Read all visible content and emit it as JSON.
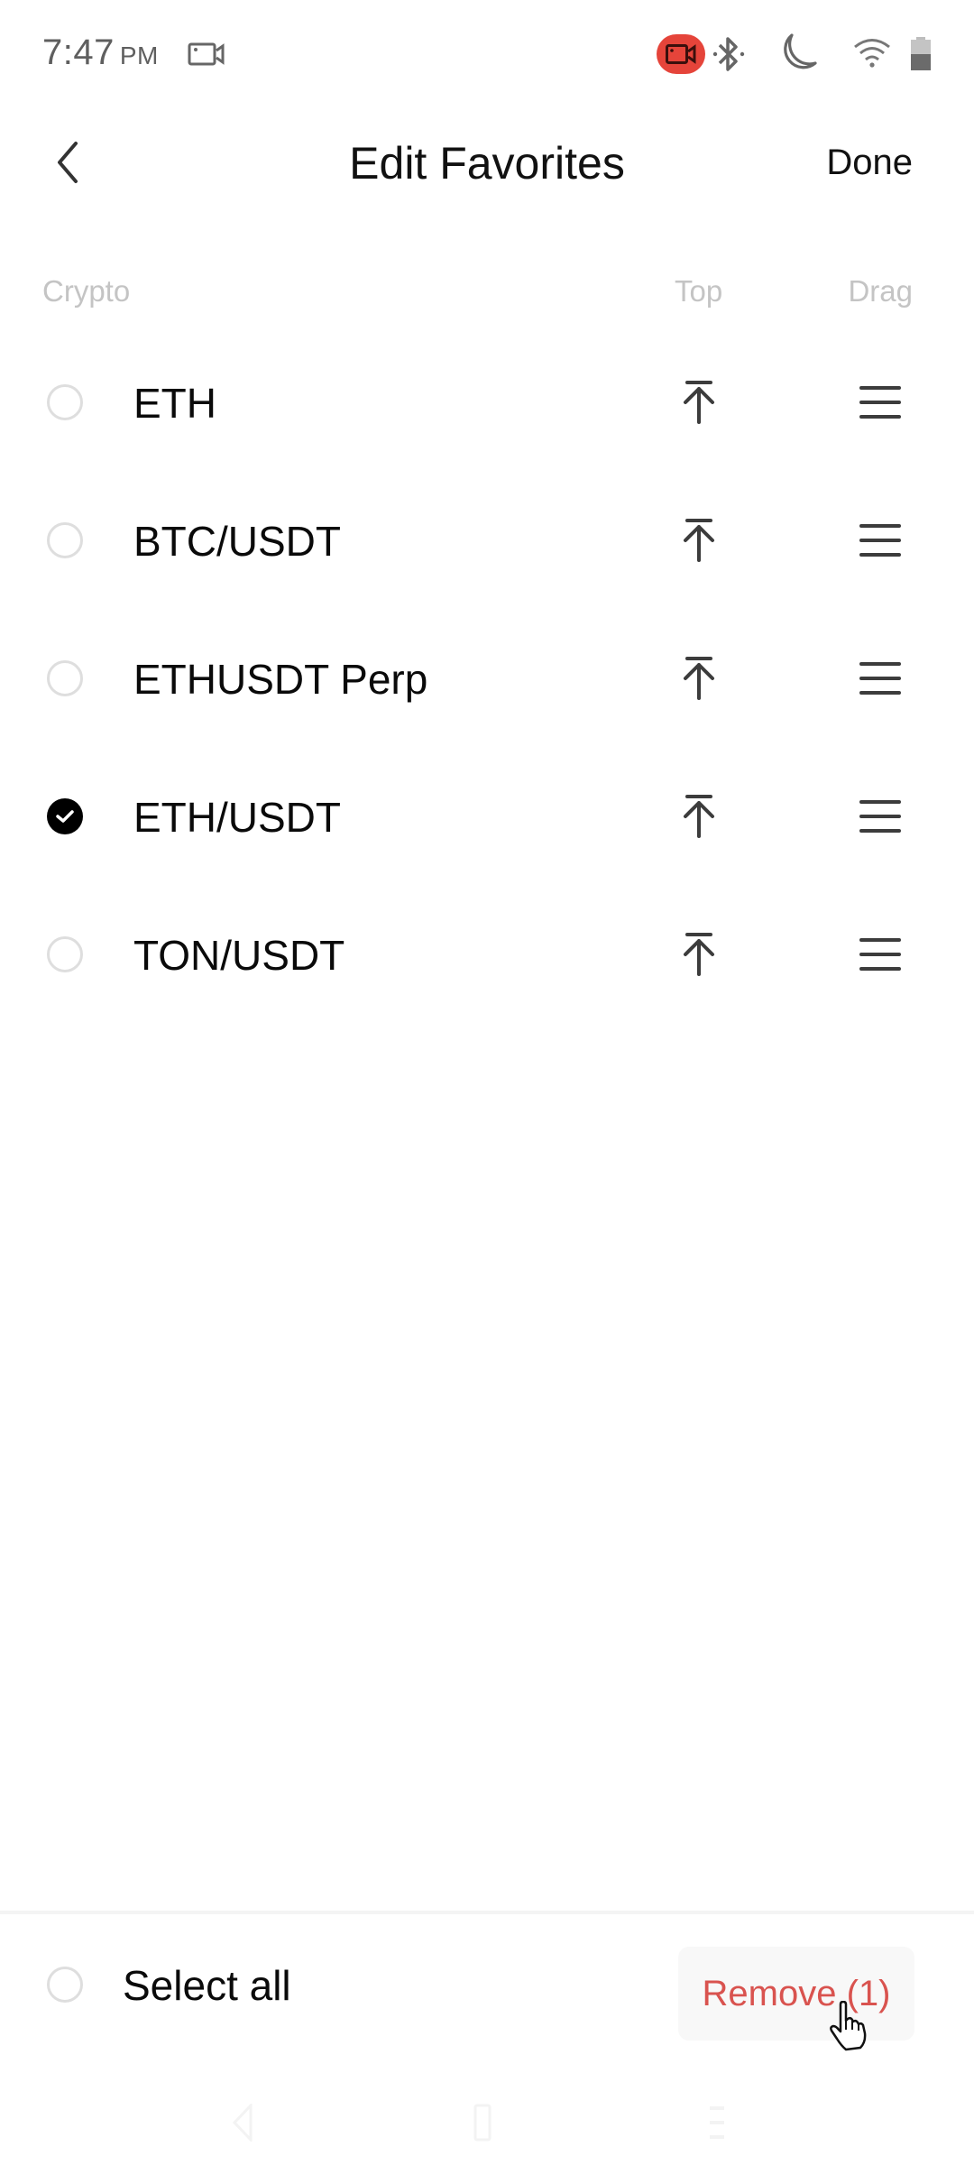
{
  "status_bar": {
    "time": "7:47",
    "ampm": "PM",
    "icons": [
      "screen-record-icon",
      "recording-camera-icon",
      "bluetooth-icon",
      "do-not-disturb-moon-icon",
      "wifi-icon",
      "battery-icon"
    ],
    "accent_recording": "#e5443a"
  },
  "header": {
    "back_icon": "chevron-left-icon",
    "title": "Edit Favorites",
    "done_label": "Done"
  },
  "columns": {
    "crypto": "Crypto",
    "top": "Top",
    "drag": "Drag"
  },
  "favorites": [
    {
      "label": "ETH",
      "checked": false
    },
    {
      "label": "BTC/USDT",
      "checked": false
    },
    {
      "label": "ETHUSDT Perp",
      "checked": false
    },
    {
      "label": "ETH/USDT",
      "checked": true
    },
    {
      "label": "TON/USDT",
      "checked": false
    }
  ],
  "bottom_bar": {
    "select_all_label": "Select all",
    "select_all_checked": false,
    "remove_label": "Remove (1)",
    "remove_color": "#d9534f"
  },
  "nav_bar": {
    "icons": [
      "nav-back-icon",
      "nav-home-icon",
      "nav-recents-icon"
    ]
  }
}
